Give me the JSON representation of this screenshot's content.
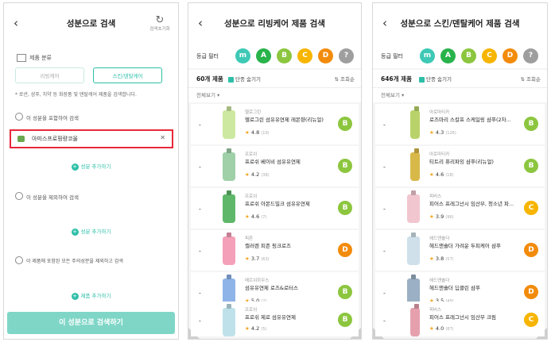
{
  "screen1": {
    "title": "성분으로 검색",
    "reset_label": "검색초기화",
    "category_label": "제품 분류",
    "seg_left": "리빙케어",
    "seg_right": "스킨/덴탈케어",
    "description": "* 로션, 샴푸, 치약 등 화장품 및 덴탈케어 제품을 검색합니다.",
    "include_label": "이 성분을 포함하여 검색",
    "include_item": "아미스프로핑량코올",
    "clear_icon": "✕",
    "add_label": "성분 추가하기",
    "exclude_label": "이 성분을 제외하여 검색",
    "caution_label": "이 제품에 포함된 모든 주의성분을 제외하고 검색",
    "add_product_label": "제품 추가하기",
    "cta": "이 성분으로 검색하기"
  },
  "screen2": {
    "title": "성분으로 리빙케어 제품 검색",
    "filter_label": "등급 필터",
    "grades": [
      "m",
      "A",
      "B",
      "C",
      "D",
      "?"
    ],
    "count": "60개 제품",
    "hide_label": "단종 숨기기",
    "sort_label": "조회순",
    "view_all": "전체보기",
    "products": [
      {
        "brand": "헬로그린",
        "name": "헬로그린 섬유유연제 레몬향(리뉴얼)",
        "rating": "4.8",
        "reviews": "(19)",
        "grade": "B"
      },
      {
        "brand": "프로쉬",
        "name": "프로쉬 베이비 섬유유연제",
        "rating": "4.2",
        "reviews": "(38)",
        "grade": "B"
      },
      {
        "brand": "프로쉬",
        "name": "프로쉬 아몬드밀크 섬유유연제",
        "rating": "4.6",
        "reviews": "(7)",
        "grade": "B"
      },
      {
        "brand": "피죤",
        "name": "캘러렌 피죤 핑크로즈",
        "rating": "3.7",
        "reviews": "(63)",
        "grade": "D"
      },
      {
        "brand": "메르쉬하우스",
        "name": "섬유유연제 로즈&로터스",
        "rating": "5.0",
        "reviews": "(2)",
        "grade": "B"
      },
      {
        "brand": "프로쉬",
        "name": "프로쉬 제로 섬유유연제",
        "rating": "4.2",
        "reviews": "(5)",
        "grade": "B"
      }
    ]
  },
  "screen3": {
    "title": "성분으로 스킨/덴탈케어 제품 검색",
    "filter_label": "등급 필터",
    "grades": [
      "m",
      "A",
      "B",
      "C",
      "D",
      "?"
    ],
    "count": "646개 제품",
    "hide_label": "단종 숨기기",
    "sort_label": "조회순",
    "view_all": "전체보기",
    "products": [
      {
        "brand": "아로마티카",
        "name": "로즈마리 스칼프 스케일링 샴푸(2차...",
        "rating": "4.3",
        "reviews": "(126)",
        "grade": "B"
      },
      {
        "brand": "아로마티카",
        "name": "티트리 퓨리파잉 샴푸(리뉴얼)",
        "rating": "4.6",
        "reviews": "(18)",
        "grade": "B"
      },
      {
        "brand": "피비스",
        "name": "피어스 프레그넌시 임산부, 청소년 파...",
        "rating": "3.9",
        "reviews": "(96)",
        "grade": "C"
      },
      {
        "brand": "헤드앤숄더",
        "name": "헤드앤숄더 가려운 두피케어 샴푸",
        "rating": "3.8",
        "reviews": "(57)",
        "grade": "D"
      },
      {
        "brand": "헤드앤숄더",
        "name": "헤드앤숄더 딥클린 샴푸",
        "rating": "3.5",
        "reviews": "(49)",
        "grade": "D"
      },
      {
        "brand": "피비스",
        "name": "피어스 프레그넌시 임산부 크림",
        "rating": "4.0",
        "reviews": "(87)",
        "grade": "C"
      }
    ]
  },
  "colors": {
    "accent": "#2dbfa8",
    "red": "#e8283a",
    "m": "#3ec9b6",
    "A": "#29b34a",
    "B": "#8cc63f",
    "C": "#f7b500",
    "D": "#f28b0c",
    "?": "#9e9e9e"
  }
}
